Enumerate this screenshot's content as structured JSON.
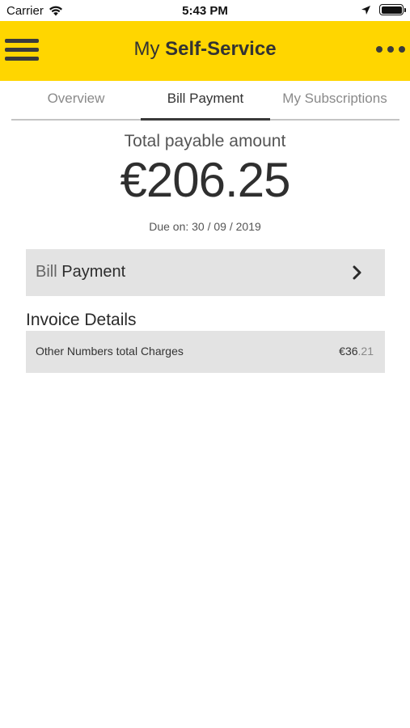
{
  "status_bar": {
    "carrier": "Carrier",
    "time": "5:43 PM"
  },
  "header": {
    "title_prefix": "My",
    "title_main": "Self-Service",
    "menu_icon": "hamburger-icon",
    "more_icon": "more-dots-icon",
    "background_color": "#ffd600"
  },
  "tabs": [
    {
      "label": "Overview",
      "active": false
    },
    {
      "label": "Bill Payment",
      "active": true
    },
    {
      "label": "My Subscriptions",
      "active": false
    }
  ],
  "total": {
    "label": "Total payable amount",
    "amount": "€206.25",
    "due": "Due on: 30 / 09 / 2019"
  },
  "bill_payment": {
    "label_light": "Bill",
    "label_strong": "Payment",
    "icon": "chevron-right-icon"
  },
  "invoice": {
    "title": "Invoice Details",
    "rows": [
      {
        "name": "Other Numbers total Charges",
        "value_main": "€36",
        "value_cents": ".21"
      }
    ]
  }
}
